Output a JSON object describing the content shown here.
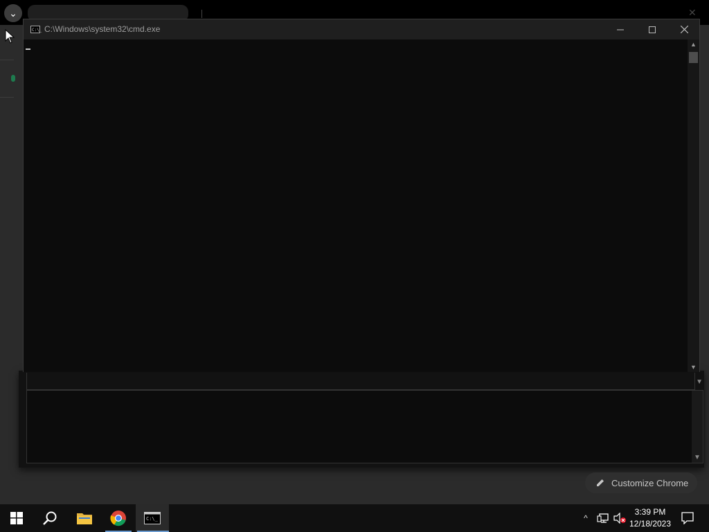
{
  "cmd_window": {
    "title": "C:\\Windows\\system32\\cmd.exe",
    "icon_label": "C:\\_",
    "controls": {
      "minimize": "—",
      "maximize": "☐",
      "close": "✕"
    }
  },
  "chrome_background": {
    "tab_search_glyph": "⌄"
  },
  "customize_chrome": {
    "label": "Customize Chrome"
  },
  "taskbar": {
    "apps": [
      "start-icon",
      "search-icon",
      "file-explorer-icon",
      "chrome-icon",
      "cmd-icon"
    ],
    "tray_chevron": "^",
    "time": "3:39 PM",
    "date": "12/18/2023"
  },
  "colors": {
    "console_bg": "#0c0c0c",
    "titlebar_bg": "#1f1f1f",
    "taskbar_bg": "#101010",
    "accent_indicator": "#6b9bd0"
  }
}
